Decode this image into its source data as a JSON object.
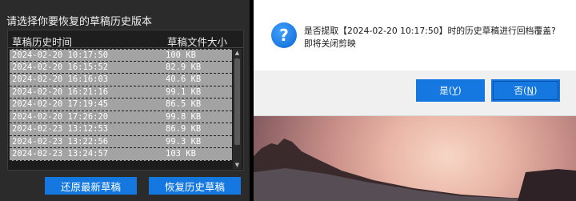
{
  "left_panel": {
    "title": "请选择你要恢复的草稿历史版本",
    "table": {
      "columns": [
        "草稿历史时间",
        "草稿文件大小"
      ],
      "rows": [
        {
          "time": "2024-02-20 10:17:50",
          "size": "100 KB"
        },
        {
          "time": "2024-02-20 16:15:52",
          "size": "82.9 KB"
        },
        {
          "time": "2024-02-20 16:16:03",
          "size": "40.6 KB"
        },
        {
          "time": "2024-02-20 16:21:16",
          "size": "99.1 KB"
        },
        {
          "time": "2024-02-20 17:19:45",
          "size": "86.5 KB"
        },
        {
          "time": "2024-02-20 17:26:20",
          "size": "99.8 KB"
        },
        {
          "time": "2024-02-23 13:12:53",
          "size": "86.9 KB"
        },
        {
          "time": "2024-02-23 13:22:56",
          "size": "99.3 KB"
        },
        {
          "time": "2024-02-23 13:24:57",
          "size": "103 KB"
        }
      ]
    },
    "buttons": {
      "restore_latest": "还原最新草稿",
      "recover_history": "恢复历史草稿"
    }
  },
  "dialog": {
    "icon": "question-icon",
    "icon_glyph": "?",
    "message_line1": "是否提取【2024-02-20 10:17:50】时的历史草稿进行回档覆盖?",
    "message_line2": "即将关闭剪映",
    "yes_label": "是",
    "yes_key": "Y",
    "no_label": "否",
    "no_key": "N"
  },
  "colors": {
    "accent": "#1478e0",
    "panel_bg": "#2b2b2b",
    "row_bg": "#a3a3a3"
  }
}
